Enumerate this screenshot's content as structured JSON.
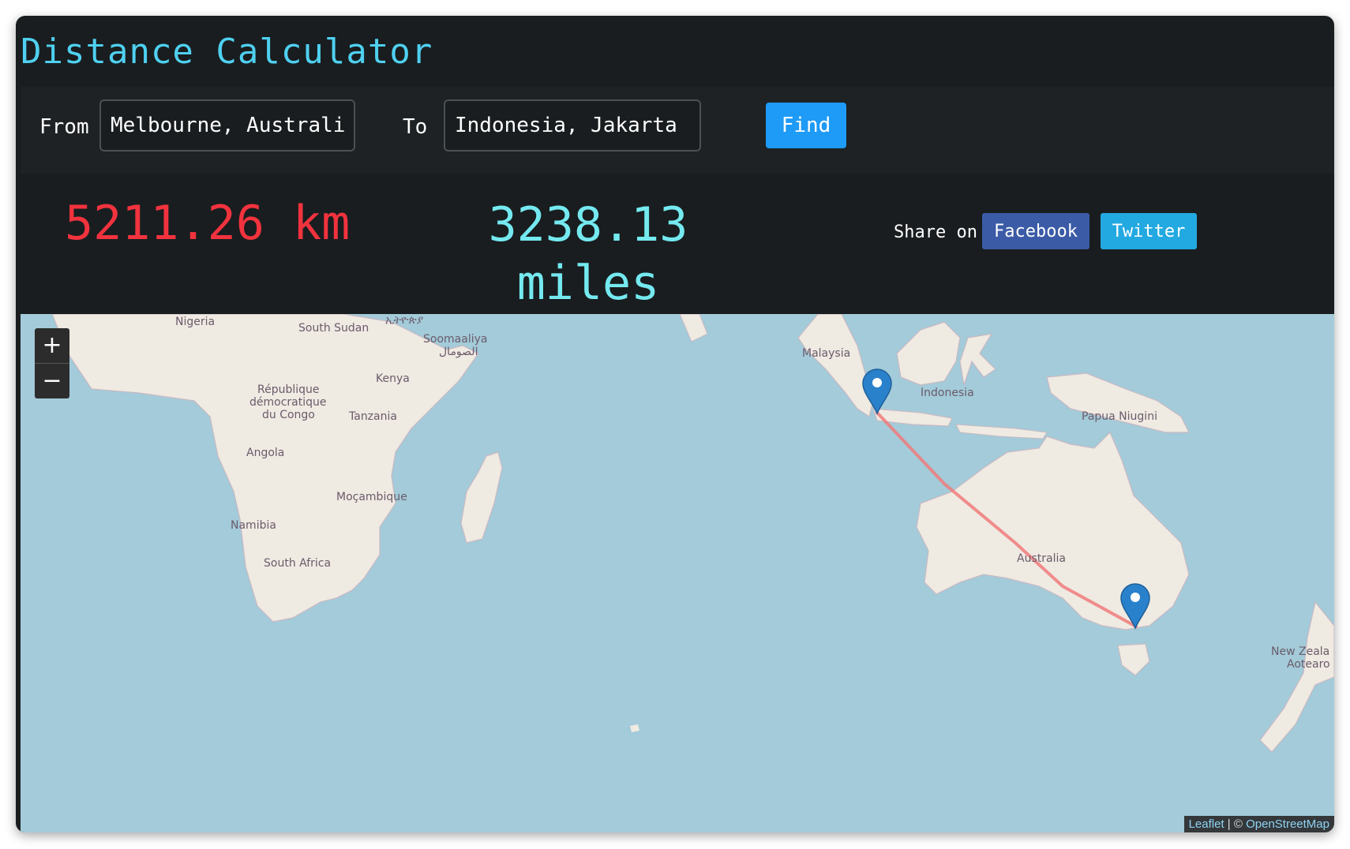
{
  "app": {
    "title": "Distance Calculator"
  },
  "form": {
    "from_label": "From",
    "from_value": "Melbourne, Australia",
    "to_label": "To",
    "to_value": "Indonesia, Jakarta",
    "find_label": "Find"
  },
  "result": {
    "km": "5211.26 km",
    "miles_value": "3238.13",
    "miles_unit": "miles"
  },
  "share": {
    "label": "Share on",
    "facebook": "Facebook",
    "twitter": "Twitter"
  },
  "map": {
    "zoom_in": "+",
    "zoom_out": "−",
    "labels": {
      "nigeria": "Nigeria",
      "south_sudan": "South Sudan",
      "ethiopia": "ኢትዮጵያ",
      "somalia": "Soomaaliya",
      "somalia_ar": "الصومال",
      "kenya": "Kenya",
      "drc_1": "République",
      "drc_2": "démocratique",
      "drc_3": "du Congo",
      "tanzania": "Tanzania",
      "angola": "Angola",
      "mozambique": "Moçambique",
      "namibia": "Namibia",
      "south_africa": "South Africa",
      "malaysia": "Malaysia",
      "indonesia": "Indonesia",
      "png": "Papua Niugini",
      "australia": "Australia",
      "nz_1": "New Zeala",
      "nz_2": "Aotearo"
    },
    "attribution_leaflet": "Leaflet",
    "attribution_sep": " | © ",
    "attribution_osm": "OpenStreetMap",
    "route_color": "#f07b7b",
    "marker_color": "#2a81cb"
  }
}
